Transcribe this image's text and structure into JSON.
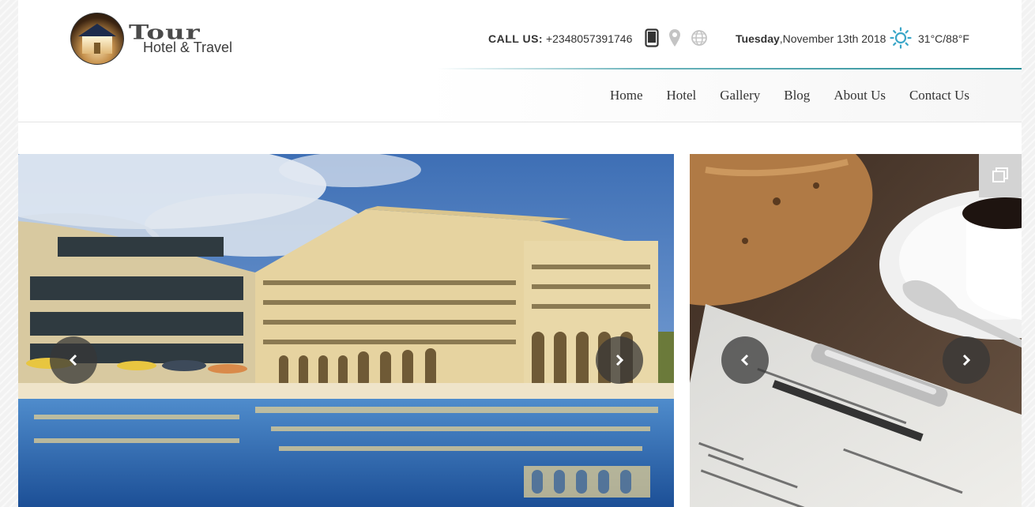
{
  "brand": {
    "title": "Tour",
    "subtitle": "Hotel & Travel"
  },
  "header": {
    "call_label": "CALL US:",
    "phone": "+2348057391746",
    "day": "Tuesday",
    "date": ",November 13th 2018",
    "temperature": "31°C/88°F"
  },
  "icons": {
    "contact": [
      "tablet-icon",
      "map-pin-icon",
      "globe-icon"
    ],
    "weather": "sun-icon",
    "slider_prev": "chevron-left-icon",
    "slider_next": "chevron-right-icon",
    "expand": "fullscreen-icon"
  },
  "nav": {
    "items": [
      {
        "label": "Home"
      },
      {
        "label": "Hotel"
      },
      {
        "label": "Gallery"
      },
      {
        "label": "Blog"
      },
      {
        "label": "About Us"
      },
      {
        "label": "Contact Us"
      }
    ]
  },
  "colors": {
    "accent": "#2a8f99",
    "sun": "#3aa6c8",
    "arrow_bg": "#373737"
  }
}
